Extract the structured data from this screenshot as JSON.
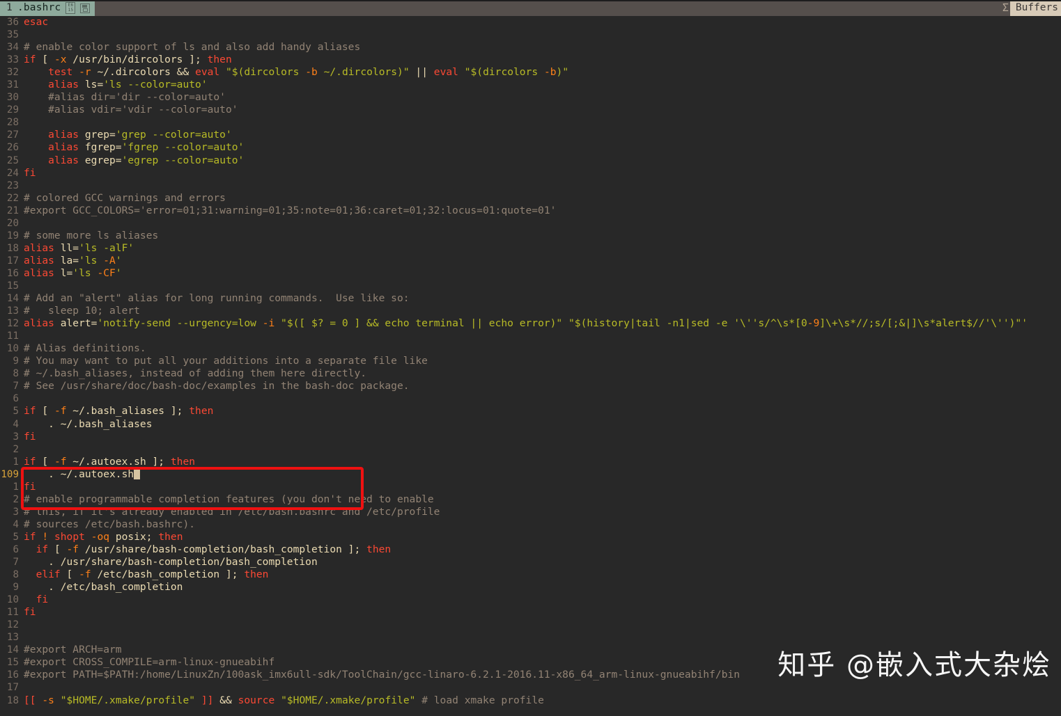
{
  "app": {
    "name": "vim",
    "theme_bg": "#282828",
    "accent_tab": "#8eaa9c",
    "highlight_box_color": "#ee1111",
    "current_line_number_color": "#d8a33a"
  },
  "tabline": {
    "tab_number": "1",
    "tab_filename": ".bashrc",
    "glyph_box_top": "E6",
    "glyph_box_bottom": "15",
    "disk_icon": "save-disk-icon",
    "separator_glyph": "Σ",
    "buffers_label": "Buffers"
  },
  "editor": {
    "current_line": "109",
    "cursor_after_text": ". ~/.autoex.sh",
    "lines": [
      {
        "num": "36",
        "segs": [
          {
            "t": "esac",
            "c": "c-kw"
          }
        ]
      },
      {
        "num": "35",
        "segs": []
      },
      {
        "num": "34",
        "segs": [
          {
            "t": "# enable color support of ls and also add handy aliases",
            "c": "c-com"
          }
        ]
      },
      {
        "num": "33",
        "segs": [
          {
            "t": "if",
            "c": "c-kw"
          },
          {
            "t": " [ ",
            "c": "c-fg"
          },
          {
            "t": "-x",
            "c": "c-opt"
          },
          {
            "t": " /usr/bin/dircolors ]; ",
            "c": "c-fg"
          },
          {
            "t": "then",
            "c": "c-kw"
          }
        ]
      },
      {
        "num": "32",
        "segs": [
          {
            "t": "    ",
            "c": "c-fg"
          },
          {
            "t": "test",
            "c": "c-kw"
          },
          {
            "t": " ",
            "c": "c-fg"
          },
          {
            "t": "-r",
            "c": "c-opt"
          },
          {
            "t": " ~/.dircolors && ",
            "c": "c-fg"
          },
          {
            "t": "eval",
            "c": "c-kw"
          },
          {
            "t": " ",
            "c": "c-fg"
          },
          {
            "t": "\"$(dircolors ",
            "c": "c-str"
          },
          {
            "t": "-b",
            "c": "c-opt"
          },
          {
            "t": " ~/.dircolors)\"",
            "c": "c-str"
          },
          {
            "t": " || ",
            "c": "c-fg"
          },
          {
            "t": "eval",
            "c": "c-kw"
          },
          {
            "t": " ",
            "c": "c-fg"
          },
          {
            "t": "\"$(dircolors ",
            "c": "c-str"
          },
          {
            "t": "-b",
            "c": "c-opt"
          },
          {
            "t": ")\"",
            "c": "c-str"
          }
        ]
      },
      {
        "num": "31",
        "segs": [
          {
            "t": "    ",
            "c": "c-fg"
          },
          {
            "t": "alias",
            "c": "c-kw"
          },
          {
            "t": " ls=",
            "c": "c-fg"
          },
          {
            "t": "'ls --color=auto'",
            "c": "c-str"
          }
        ]
      },
      {
        "num": "30",
        "segs": [
          {
            "t": "    #alias dir='dir --color=auto'",
            "c": "c-com"
          }
        ]
      },
      {
        "num": "29",
        "segs": [
          {
            "t": "    #alias vdir='vdir --color=auto'",
            "c": "c-com"
          }
        ]
      },
      {
        "num": "28",
        "segs": []
      },
      {
        "num": "27",
        "segs": [
          {
            "t": "    ",
            "c": "c-fg"
          },
          {
            "t": "alias",
            "c": "c-kw"
          },
          {
            "t": " grep=",
            "c": "c-fg"
          },
          {
            "t": "'grep --color=auto'",
            "c": "c-str"
          }
        ]
      },
      {
        "num": "26",
        "segs": [
          {
            "t": "    ",
            "c": "c-fg"
          },
          {
            "t": "alias",
            "c": "c-kw"
          },
          {
            "t": " fgrep=",
            "c": "c-fg"
          },
          {
            "t": "'fgrep --color=auto'",
            "c": "c-str"
          }
        ]
      },
      {
        "num": "25",
        "segs": [
          {
            "t": "    ",
            "c": "c-fg"
          },
          {
            "t": "alias",
            "c": "c-kw"
          },
          {
            "t": " egrep=",
            "c": "c-fg"
          },
          {
            "t": "'egrep --color=auto'",
            "c": "c-str"
          }
        ]
      },
      {
        "num": "24",
        "segs": [
          {
            "t": "fi",
            "c": "c-kw"
          }
        ]
      },
      {
        "num": "23",
        "segs": []
      },
      {
        "num": "22",
        "segs": [
          {
            "t": "# colored GCC warnings and errors",
            "c": "c-com"
          }
        ]
      },
      {
        "num": "21",
        "segs": [
          {
            "t": "#export GCC_COLORS='error=01;31:warning=01;35:note=01;36:caret=01;32:locus=01:quote=01'",
            "c": "c-com"
          }
        ]
      },
      {
        "num": "20",
        "segs": []
      },
      {
        "num": "19",
        "segs": [
          {
            "t": "# some more ls aliases",
            "c": "c-com"
          }
        ]
      },
      {
        "num": "18",
        "segs": [
          {
            "t": "alias",
            "c": "c-kw"
          },
          {
            "t": " ll=",
            "c": "c-fg"
          },
          {
            "t": "'ls -alF'",
            "c": "c-str"
          }
        ]
      },
      {
        "num": "17",
        "segs": [
          {
            "t": "alias",
            "c": "c-kw"
          },
          {
            "t": " la=",
            "c": "c-fg"
          },
          {
            "t": "'ls ",
            "c": "c-str"
          },
          {
            "t": "-A",
            "c": "c-opt"
          },
          {
            "t": "'",
            "c": "c-str"
          }
        ]
      },
      {
        "num": "16",
        "segs": [
          {
            "t": "alias",
            "c": "c-kw"
          },
          {
            "t": " l=",
            "c": "c-fg"
          },
          {
            "t": "'ls ",
            "c": "c-str"
          },
          {
            "t": "-CF",
            "c": "c-opt"
          },
          {
            "t": "'",
            "c": "c-str"
          }
        ]
      },
      {
        "num": "15",
        "segs": []
      },
      {
        "num": "14",
        "segs": [
          {
            "t": "# Add an \"alert\" alias for long running commands.  Use like so:",
            "c": "c-com"
          }
        ]
      },
      {
        "num": "13",
        "segs": [
          {
            "t": "#   sleep 10; alert",
            "c": "c-com"
          }
        ]
      },
      {
        "num": "12",
        "segs": [
          {
            "t": "alias",
            "c": "c-kw"
          },
          {
            "t": " alert=",
            "c": "c-fg"
          },
          {
            "t": "'notify-send --urgency=low ",
            "c": "c-str"
          },
          {
            "t": "-i",
            "c": "c-opt"
          },
          {
            "t": " \"$([ $? = 0 ] && echo terminal || echo error)\" \"$(history|tail -n1|sed -e '\\''s/^\\s*[0",
            "c": "c-str"
          },
          {
            "t": "-9",
            "c": "c-opt"
          },
          {
            "t": "]\\+\\s*//;s/[;&|]\\s*alert$//'\\'')\"'",
            "c": "c-str"
          }
        ]
      },
      {
        "num": "11",
        "segs": []
      },
      {
        "num": "10",
        "segs": [
          {
            "t": "# Alias definitions.",
            "c": "c-com"
          }
        ]
      },
      {
        "num": "9",
        "segs": [
          {
            "t": "# You may want to put all your additions into a separate file like",
            "c": "c-com"
          }
        ]
      },
      {
        "num": "8",
        "segs": [
          {
            "t": "# ~/.bash_aliases, instead of adding them here directly.",
            "c": "c-com"
          }
        ]
      },
      {
        "num": "7",
        "segs": [
          {
            "t": "# See /usr/share/doc/bash-doc/examples in the bash-doc package.",
            "c": "c-com"
          }
        ]
      },
      {
        "num": "6",
        "segs": []
      },
      {
        "num": "5",
        "segs": [
          {
            "t": "if",
            "c": "c-kw"
          },
          {
            "t": " [ ",
            "c": "c-fg"
          },
          {
            "t": "-f",
            "c": "c-opt"
          },
          {
            "t": " ~/.bash_aliases ]; ",
            "c": "c-fg"
          },
          {
            "t": "then",
            "c": "c-kw"
          }
        ]
      },
      {
        "num": "4",
        "segs": [
          {
            "t": "    . ~/.bash_aliases",
            "c": "c-fg"
          }
        ]
      },
      {
        "num": "3",
        "segs": [
          {
            "t": "fi",
            "c": "c-kw"
          }
        ]
      },
      {
        "num": "2",
        "segs": []
      },
      {
        "num": "1",
        "segs": [
          {
            "t": "if",
            "c": "c-kw"
          },
          {
            "t": " [ ",
            "c": "c-fg"
          },
          {
            "t": "-f",
            "c": "c-opt"
          },
          {
            "t": " ~/.autoex.sh ]; ",
            "c": "c-fg"
          },
          {
            "t": "then",
            "c": "c-kw"
          }
        ]
      },
      {
        "num": "109",
        "current": true,
        "segs": [
          {
            "t": "    . ~/.autoex.sh",
            "c": "c-fg"
          }
        ],
        "cursor": true
      },
      {
        "num": "1",
        "segs": [
          {
            "t": "fi",
            "c": "c-kw"
          }
        ]
      },
      {
        "num": "2",
        "segs": [
          {
            "t": "# enable programmable completion features (you don't need to enable",
            "c": "c-com"
          }
        ]
      },
      {
        "num": "3",
        "segs": [
          {
            "t": "# this, if it's already enabled in /etc/bash.bashrc and /etc/profile",
            "c": "c-com"
          }
        ]
      },
      {
        "num": "4",
        "segs": [
          {
            "t": "# sources /etc/bash.bashrc).",
            "c": "c-com"
          }
        ]
      },
      {
        "num": "5",
        "segs": [
          {
            "t": "if",
            "c": "c-kw"
          },
          {
            "t": " ",
            "c": "c-fg"
          },
          {
            "t": "!",
            "c": "c-opt"
          },
          {
            "t": " ",
            "c": "c-fg"
          },
          {
            "t": "shopt",
            "c": "c-kw"
          },
          {
            "t": " ",
            "c": "c-fg"
          },
          {
            "t": "-oq",
            "c": "c-opt"
          },
          {
            "t": " posix; ",
            "c": "c-fg"
          },
          {
            "t": "then",
            "c": "c-kw"
          }
        ]
      },
      {
        "num": "6",
        "segs": [
          {
            "t": "  ",
            "c": "c-fg"
          },
          {
            "t": "if",
            "c": "c-kw"
          },
          {
            "t": " [ ",
            "c": "c-fg"
          },
          {
            "t": "-f",
            "c": "c-opt"
          },
          {
            "t": " /usr/share/bash-completion/bash_completion ]; ",
            "c": "c-fg"
          },
          {
            "t": "then",
            "c": "c-kw"
          }
        ]
      },
      {
        "num": "7",
        "segs": [
          {
            "t": "    . /usr/share/bash-completion/bash_completion",
            "c": "c-fg"
          }
        ]
      },
      {
        "num": "8",
        "segs": [
          {
            "t": "  ",
            "c": "c-fg"
          },
          {
            "t": "elif",
            "c": "c-kw"
          },
          {
            "t": " [ ",
            "c": "c-fg"
          },
          {
            "t": "-f",
            "c": "c-opt"
          },
          {
            "t": " /etc/bash_completion ]; ",
            "c": "c-fg"
          },
          {
            "t": "then",
            "c": "c-kw"
          }
        ]
      },
      {
        "num": "9",
        "segs": [
          {
            "t": "    . /etc/bash_completion",
            "c": "c-fg"
          }
        ]
      },
      {
        "num": "10",
        "segs": [
          {
            "t": "  ",
            "c": "c-fg"
          },
          {
            "t": "fi",
            "c": "c-kw"
          }
        ]
      },
      {
        "num": "11",
        "segs": [
          {
            "t": "fi",
            "c": "c-kw"
          }
        ]
      },
      {
        "num": "12",
        "segs": []
      },
      {
        "num": "13",
        "segs": []
      },
      {
        "num": "14",
        "segs": [
          {
            "t": "#export ARCH=arm",
            "c": "c-com"
          }
        ]
      },
      {
        "num": "15",
        "segs": [
          {
            "t": "#export CROSS_COMPILE=arm-linux-gnueabihf",
            "c": "c-com"
          }
        ]
      },
      {
        "num": "16",
        "segs": [
          {
            "t": "#export PATH=$PATH:/home/LinuxZn/100ask_imx6ull-sdk/ToolChain/gcc-linaro-6.2.1-2016.11-x86_64_arm-linux-gnueabihf/bin",
            "c": "c-com"
          }
        ]
      },
      {
        "num": "17",
        "segs": []
      },
      {
        "num": "18",
        "segs": [
          {
            "t": "[[",
            "c": "c-kw"
          },
          {
            "t": " ",
            "c": "c-fg"
          },
          {
            "t": "-s",
            "c": "c-opt"
          },
          {
            "t": " ",
            "c": "c-fg"
          },
          {
            "t": "\"$HOME/.xmake/profile\"",
            "c": "c-str"
          },
          {
            "t": " ",
            "c": "c-fg"
          },
          {
            "t": "]]",
            "c": "c-kw"
          },
          {
            "t": " && ",
            "c": "c-fg"
          },
          {
            "t": "source",
            "c": "c-kw"
          },
          {
            "t": " ",
            "c": "c-fg"
          },
          {
            "t": "\"$HOME/.xmake/profile\"",
            "c": "c-str"
          },
          {
            "t": " ",
            "c": "c-fg"
          },
          {
            "t": "# load xmake profile",
            "c": "c-com"
          }
        ]
      }
    ]
  },
  "watermark": {
    "text": "知乎 @嵌入式大杂烩"
  }
}
